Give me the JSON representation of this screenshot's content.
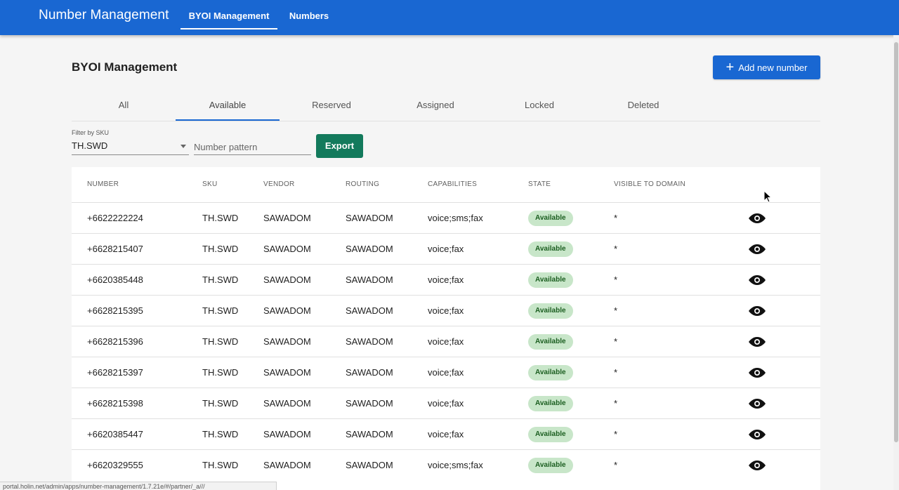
{
  "appbar": {
    "title": "Number Management",
    "tabs": [
      {
        "label": "BYOI Management",
        "active": true
      },
      {
        "label": "Numbers",
        "active": false
      }
    ]
  },
  "page": {
    "title": "BYOI Management",
    "add_button": {
      "label": "Add new number",
      "icon": "plus-icon"
    }
  },
  "state_tabs": [
    {
      "label": "All",
      "active": false
    },
    {
      "label": "Available",
      "active": true
    },
    {
      "label": "Reserved",
      "active": false
    },
    {
      "label": "Assigned",
      "active": false
    },
    {
      "label": "Locked",
      "active": false
    },
    {
      "label": "Deleted",
      "active": false
    }
  ],
  "filters": {
    "sku_label": "Filter by SKU",
    "sku_value": "TH.SWD",
    "pattern_placeholder": "Number pattern",
    "export_label": "Export"
  },
  "table": {
    "headers": [
      "NUMBER",
      "SKU",
      "VENDOR",
      "ROUTING",
      "CAPABILITIES",
      "STATE",
      "VISIBLE TO DOMAIN"
    ],
    "rows": [
      {
        "number": "+6622222224",
        "sku": "TH.SWD",
        "vendor": "SAWADOM",
        "routing": "SAWADOM",
        "capabilities": "voice;sms;fax",
        "state": "Available",
        "visible": "*"
      },
      {
        "number": "+6628215407",
        "sku": "TH.SWD",
        "vendor": "SAWADOM",
        "routing": "SAWADOM",
        "capabilities": "voice;fax",
        "state": "Available",
        "visible": "*"
      },
      {
        "number": "+6620385448",
        "sku": "TH.SWD",
        "vendor": "SAWADOM",
        "routing": "SAWADOM",
        "capabilities": "voice;fax",
        "state": "Available",
        "visible": "*"
      },
      {
        "number": "+6628215395",
        "sku": "TH.SWD",
        "vendor": "SAWADOM",
        "routing": "SAWADOM",
        "capabilities": "voice;fax",
        "state": "Available",
        "visible": "*"
      },
      {
        "number": "+6628215396",
        "sku": "TH.SWD",
        "vendor": "SAWADOM",
        "routing": "SAWADOM",
        "capabilities": "voice;fax",
        "state": "Available",
        "visible": "*"
      },
      {
        "number": "+6628215397",
        "sku": "TH.SWD",
        "vendor": "SAWADOM",
        "routing": "SAWADOM",
        "capabilities": "voice;fax",
        "state": "Available",
        "visible": "*"
      },
      {
        "number": "+6628215398",
        "sku": "TH.SWD",
        "vendor": "SAWADOM",
        "routing": "SAWADOM",
        "capabilities": "voice;fax",
        "state": "Available",
        "visible": "*"
      },
      {
        "number": "+6620385447",
        "sku": "TH.SWD",
        "vendor": "SAWADOM",
        "routing": "SAWADOM",
        "capabilities": "voice;fax",
        "state": "Available",
        "visible": "*"
      },
      {
        "number": "+6620329555",
        "sku": "TH.SWD",
        "vendor": "SAWADOM",
        "routing": "SAWADOM",
        "capabilities": "voice;sms;fax",
        "state": "Available",
        "visible": "*"
      }
    ],
    "row_action_icon": "eye-icon"
  },
  "status_bar": {
    "url": "portal.holin.net/admin/apps/number-management/1.7.21e/#/partner/_a///"
  },
  "colors": {
    "primary": "#1967d2",
    "export": "#137a5c",
    "badge_bg": "#c8e6c9",
    "badge_text": "#1b5e20"
  }
}
